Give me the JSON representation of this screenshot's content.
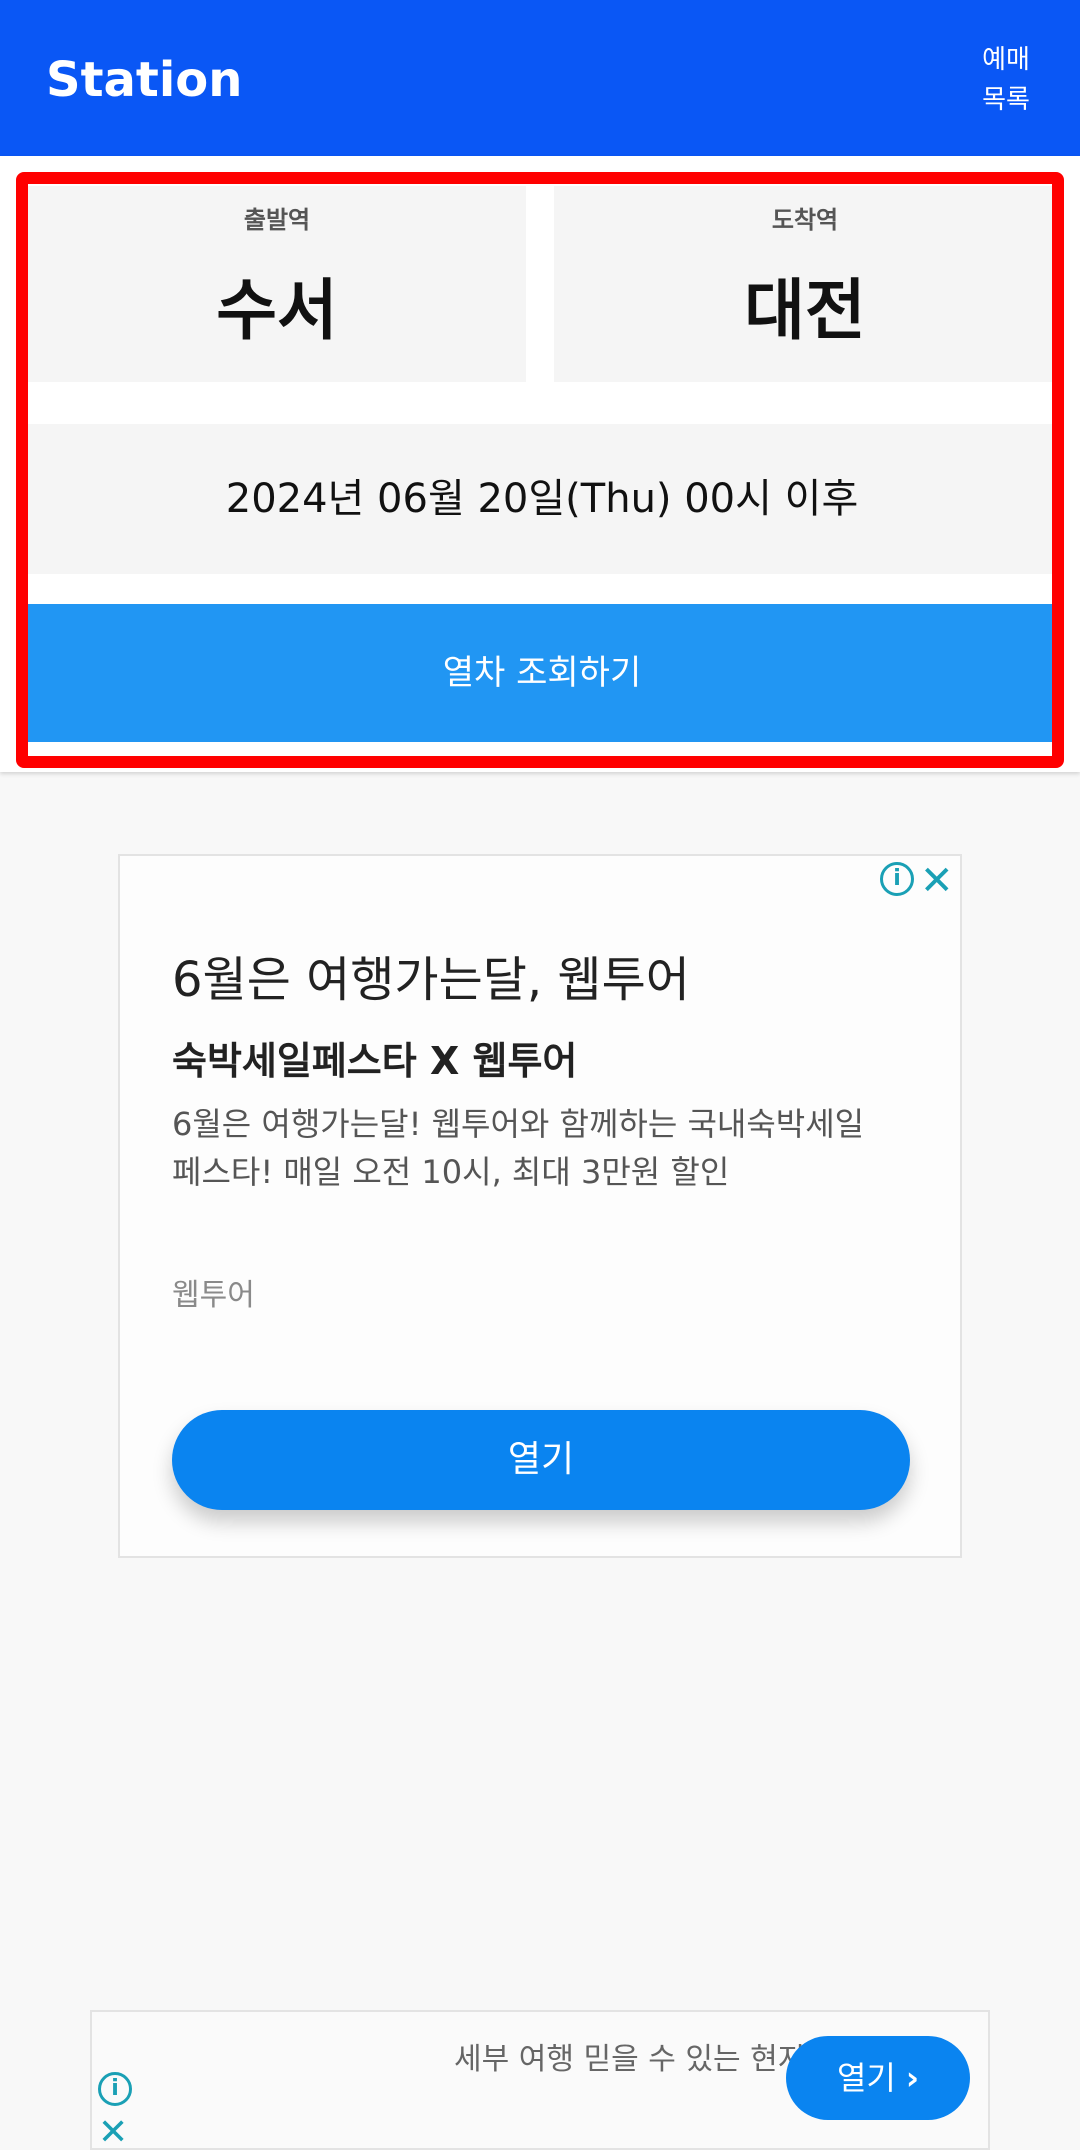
{
  "app": {
    "title": "Station",
    "menu_label": "예매 목록"
  },
  "form": {
    "departure_label": "출발역",
    "departure_station": "수서",
    "arrival_label": "도착역",
    "arrival_station": "대전",
    "datetime": "2024년 06월 20일(Thu) 00시 이후",
    "search_button": "열차 조회하기"
  },
  "ad": {
    "info_icon": "info-icon",
    "close_icon": "close-icon",
    "headline": "6월은 여행가는달, 웹투어",
    "subheadline": "숙박세일페스타 X 웹투어",
    "body": "6월은 여행가는달! 웹투어와 함께하는 국내숙박세일페스타! 매일 오전 10시, 최대 3만원 할인",
    "advertiser": "웹투어",
    "open_button": "열기"
  },
  "banner_ad": {
    "text": "세부 여행 믿을 수 있는 현지업체와 함께 안전하고 즐겁게",
    "open_button": "열기",
    "info_icon": "info-icon",
    "close_icon": "close-icon"
  },
  "colors": {
    "appbar": "#0a57f5",
    "search_button": "#2196f3",
    "ad_button": "#0a84f0",
    "highlight": "#ff0000"
  }
}
